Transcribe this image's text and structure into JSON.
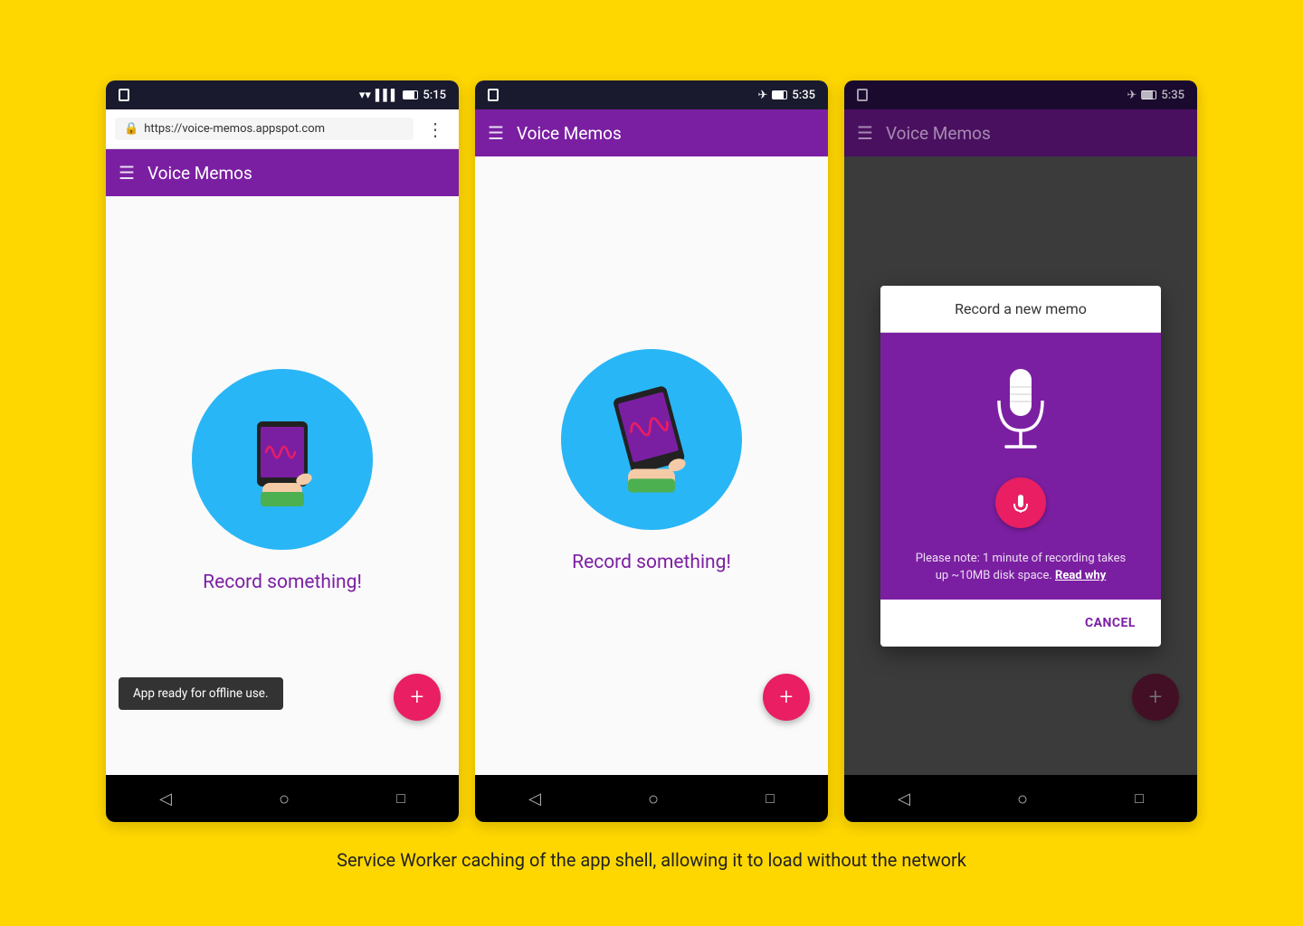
{
  "page": {
    "background": "#FFD700",
    "caption": "Service Worker caching of the app shell, allowing it to load without the network"
  },
  "phone1": {
    "status_bar": {
      "time": "5:15",
      "icons": [
        "wifi",
        "signal",
        "battery"
      ]
    },
    "browser_bar": {
      "url": "https://voice-memos.appspot.com",
      "menu_icon": "⋮"
    },
    "toolbar": {
      "menu_icon": "☰",
      "title": "Voice Memos"
    },
    "content": {
      "record_text": "Record something!",
      "fab_label": "+"
    },
    "snackbar": {
      "text": "App ready for offline use."
    },
    "nav_bar": {
      "back": "◁",
      "home": "○",
      "recents": "□"
    }
  },
  "phone2": {
    "status_bar": {
      "time": "5:35",
      "icons": [
        "airplane",
        "battery"
      ]
    },
    "toolbar": {
      "menu_icon": "☰",
      "title": "Voice Memos"
    },
    "content": {
      "record_text": "Record something!",
      "fab_label": "+"
    },
    "nav_bar": {
      "back": "◁",
      "home": "○",
      "recents": "□"
    }
  },
  "phone3": {
    "status_bar": {
      "time": "5:35",
      "icons": [
        "airplane",
        "battery"
      ]
    },
    "toolbar": {
      "menu_icon": "☰",
      "title": "Voice Memos"
    },
    "dialog": {
      "title": "Record a new memo",
      "note": "Please note: 1 minute of recording takes up ~10MB disk space.",
      "note_link": "Read why",
      "cancel_label": "CANCEL"
    },
    "fab_label": "+",
    "nav_bar": {
      "back": "◁",
      "home": "○",
      "recents": "□"
    }
  }
}
